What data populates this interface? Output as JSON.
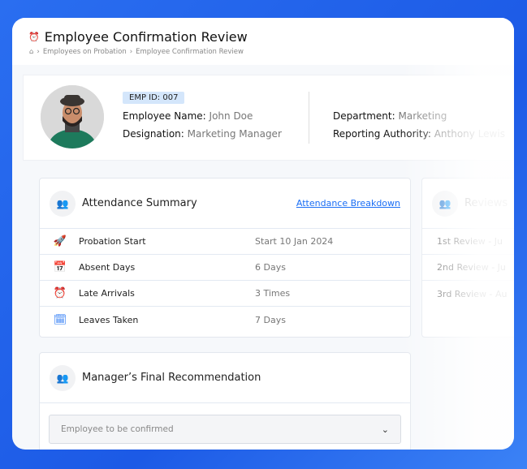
{
  "header": {
    "title": "Employee Confirmation Review",
    "breadcrumb": [
      "Employees on Probation",
      "Employee Confirmation Review"
    ]
  },
  "profile": {
    "emp_id": "EMP ID: 007",
    "name_label": "Employee Name:",
    "name": "John Doe",
    "designation_label": "Designation:",
    "designation": "Marketing Manager",
    "department_label": "Department:",
    "department": "Marketing",
    "authority_label": "Reporting Authority:",
    "authority": "Anthony Lewis"
  },
  "attendance": {
    "title": "Attendance Summary",
    "link": "Attendance Breakdown",
    "rows": [
      {
        "label": "Probation Start",
        "value": "Start 10 Jan 2024",
        "icon": "rocket-icon"
      },
      {
        "label": "Absent Days",
        "value": "6 Days",
        "icon": "calendar-person-icon"
      },
      {
        "label": "Late Arrivals",
        "value": "3 Times",
        "icon": "alarm-clock-icon"
      },
      {
        "label": "Leaves Taken",
        "value": "7 Days",
        "icon": "calendar-exit-icon"
      }
    ]
  },
  "reviews": {
    "title": "Reviews",
    "rows": [
      "1st Review - Ju",
      "2nd Review - Ju",
      "3rd Review - Au"
    ]
  },
  "recommendation": {
    "title": "Manager’s Final Recommendation",
    "selected": "Employee to be confirmed"
  }
}
